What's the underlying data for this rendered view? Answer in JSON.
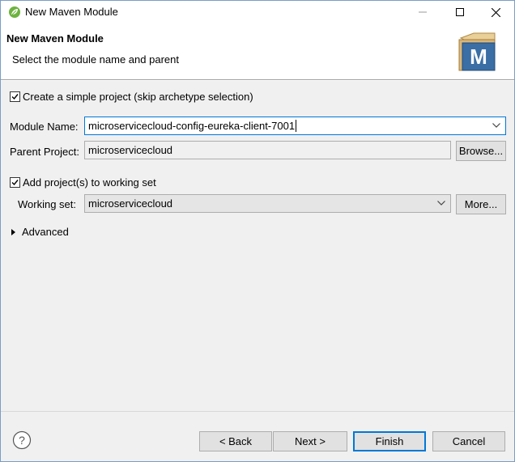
{
  "window": {
    "title": "New Maven Module",
    "icons": {
      "app": "spring-leaf-icon",
      "minimize": "minimize-icon",
      "maximize": "maximize-icon",
      "close": "close-icon"
    }
  },
  "banner": {
    "title": "New Maven Module",
    "subtitle": "Select the module name and parent",
    "logo_letter": "M"
  },
  "form": {
    "simple_project": {
      "label": "Create a simple project (skip archetype selection)",
      "checked": true
    },
    "module_name": {
      "label": "Module Name:",
      "value": "microservicecloud-config-eureka-client-7001"
    },
    "parent_project": {
      "label": "Parent Project:",
      "value": "microservicecloud",
      "browse_label": "Browse..."
    },
    "working_set_check": {
      "label": "Add project(s) to working set",
      "checked": true
    },
    "working_set": {
      "label": "Working set:",
      "value": "microservicecloud",
      "more_label": "More..."
    },
    "advanced": {
      "label": "Advanced"
    }
  },
  "footer": {
    "help_icon": "help-icon",
    "back_label": "< Back",
    "next_label": "Next >",
    "finish_label": "Finish",
    "cancel_label": "Cancel"
  },
  "colors": {
    "accent": "#0078d7",
    "panel": "#f0f0f0",
    "logo_blue": "#3a6ea5",
    "logo_tan": "#d9b77a"
  }
}
